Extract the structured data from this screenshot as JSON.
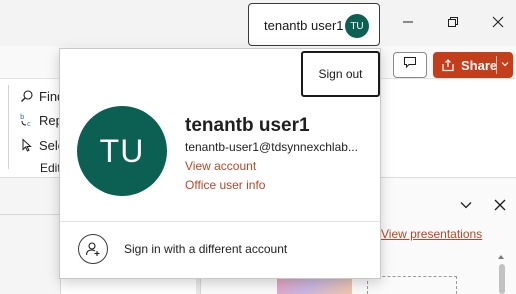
{
  "account_button": {
    "name": "tenantb user1",
    "initials": "TU"
  },
  "title_bar": {
    "minimize_icon": "minimize-icon",
    "restore_icon": "restore-icon",
    "close_icon": "close-icon"
  },
  "ribbon": {
    "comments_icon": "comment-icon",
    "share_label": "Share",
    "editing": {
      "find_label": "Find",
      "replace_label": "Replace",
      "select_label": "Select",
      "group_label": "Editing"
    }
  },
  "flyout": {
    "sign_out_label": "Sign out",
    "avatar_initials": "TU",
    "user_name": "tenantb user1",
    "user_email": "tenantb-user1@tdsynnexchlab...",
    "view_account_label": "View account",
    "office_user_info_label": "Office user info",
    "sign_in_different_label": "Sign in with a different account"
  },
  "designer_pane": {
    "view_presentations_label": "View presentations"
  },
  "colors": {
    "avatar_bg": "#0c5f53",
    "share_bg": "#c43e1c",
    "link": "#b7472a"
  }
}
